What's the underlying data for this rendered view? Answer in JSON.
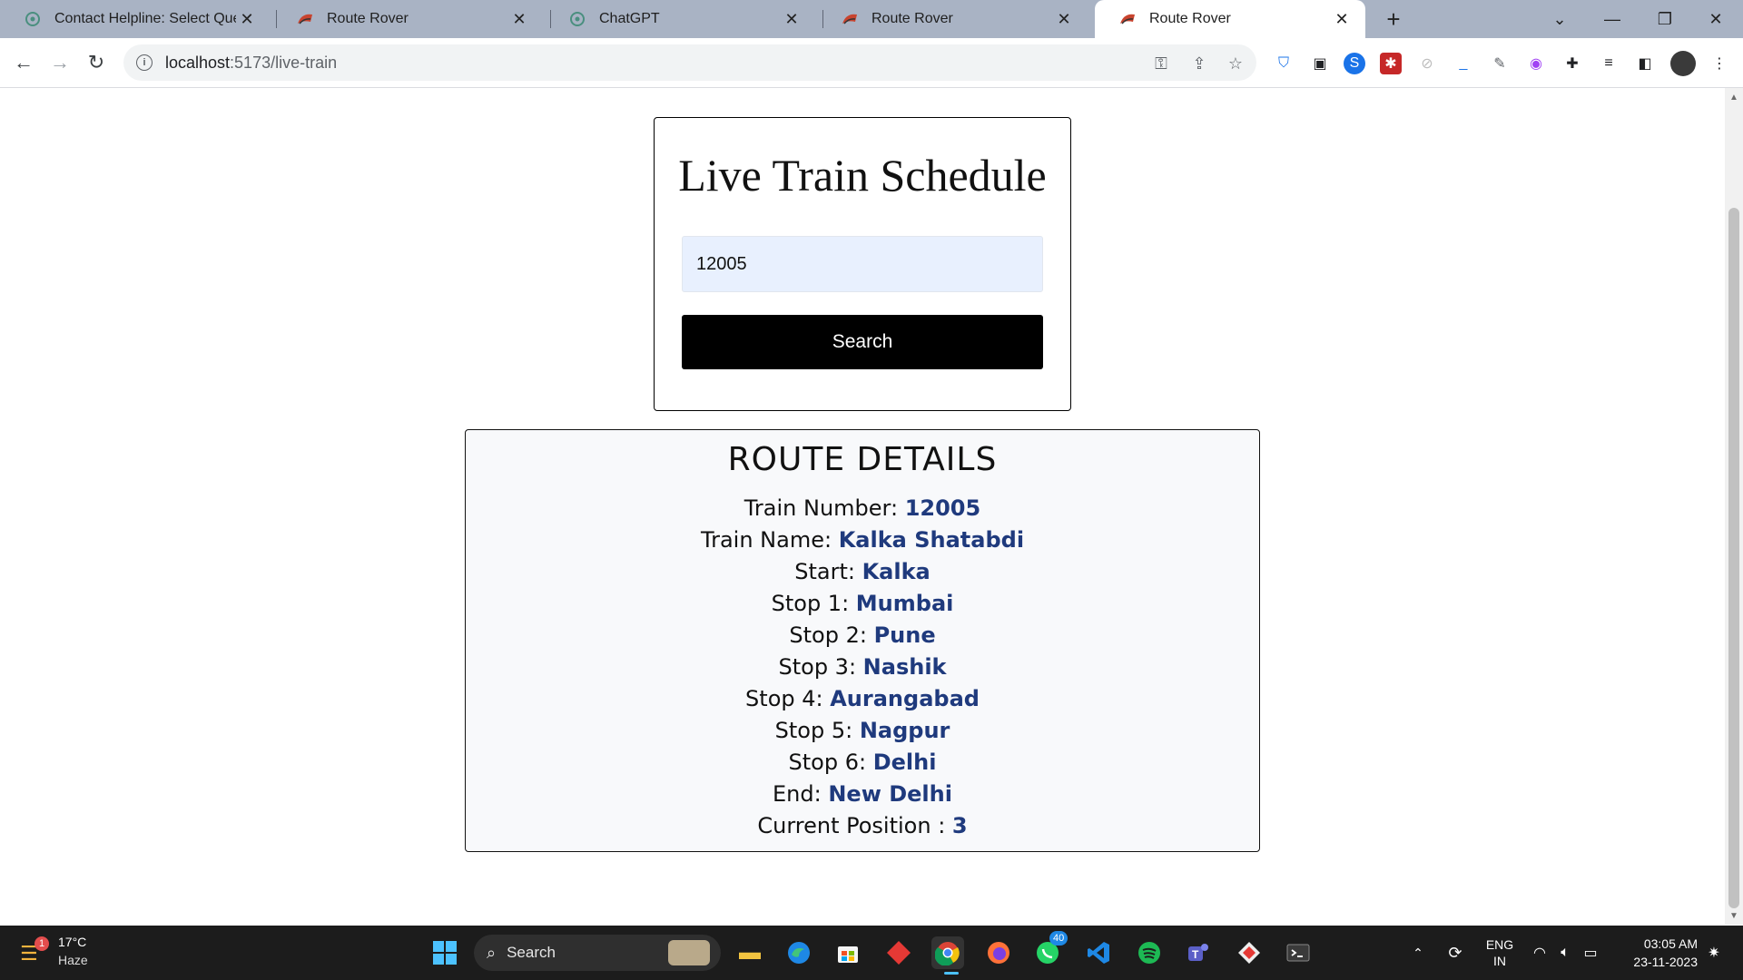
{
  "browser": {
    "tabs": [
      {
        "title": "Contact Helpline: Select Query",
        "icon": "chatgpt-icon",
        "active": false
      },
      {
        "title": "Route Rover",
        "icon": "train-icon",
        "active": false
      },
      {
        "title": "ChatGPT",
        "icon": "chatgpt-icon",
        "active": false
      },
      {
        "title": "Route Rover",
        "icon": "train-icon",
        "active": false
      },
      {
        "title": "Route Rover",
        "icon": "train-icon",
        "active": true
      }
    ],
    "url_host": "localhost",
    "url_path": ":5173/live-train"
  },
  "page": {
    "search_card": {
      "title": "Live Train Schedule",
      "input_value": "12005",
      "button_label": "Search"
    },
    "route": {
      "heading": "ROUTE DETAILS",
      "rows": [
        {
          "label": "Train Number: ",
          "value": "12005"
        },
        {
          "label": "Train Name: ",
          "value": "Kalka Shatabdi"
        },
        {
          "label": "Start: ",
          "value": "Kalka"
        },
        {
          "label": "Stop 1: ",
          "value": "Mumbai"
        },
        {
          "label": "Stop 2: ",
          "value": "Pune"
        },
        {
          "label": "Stop 3: ",
          "value": "Nashik"
        },
        {
          "label": "Stop 4: ",
          "value": "Aurangabad"
        },
        {
          "label": "Stop 5: ",
          "value": "Nagpur"
        },
        {
          "label": "Stop 6: ",
          "value": "Delhi"
        },
        {
          "label": "End: ",
          "value": "New Delhi"
        },
        {
          "label": "Current Position : ",
          "value": "3"
        }
      ]
    }
  },
  "taskbar": {
    "weather_temp": "17°C",
    "weather_cond": "Haze",
    "weather_badge": "1",
    "search_label": "Search",
    "whatsapp_badge": "40",
    "lang_top": "ENG",
    "lang_bottom": "IN",
    "time": "03:05 AM",
    "date": "23-11-2023"
  },
  "colors": {
    "value_text": "#1f3a7d",
    "tabstrip": "#a9b3c4",
    "input_bg": "#e8f0fe"
  }
}
